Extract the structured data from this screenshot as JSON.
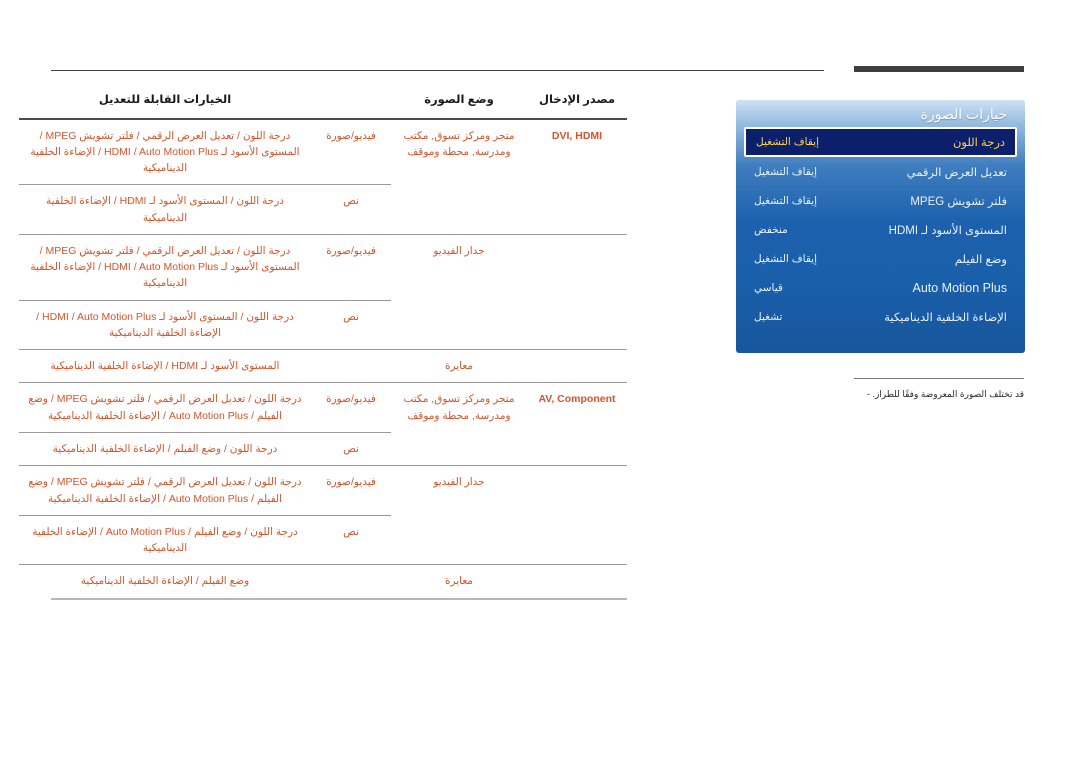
{
  "table": {
    "headers": {
      "source": "مصدر الإدخال",
      "picture_mode": "وضع الصورة",
      "options": "الخيارات القابلة للتعديل"
    },
    "rows": [
      {
        "source": "DVI, HDMI",
        "picture_mode": "متجر ومركز تسوق, مكتب ومدرسة, محطة وموقف",
        "sub_mode": "فيديو/صورة",
        "options": "درجة اللون / تعديل العرض الرقمي / فلتر تشويش MPEG / المستوى الأسود لـ HDMI / Auto Motion Plus / الإضاءة الخلفية الديناميكية"
      },
      {
        "source": "",
        "picture_mode": "",
        "sub_mode": "نص",
        "options": "درجة اللون / المستوى الأسود لـ HDMI / الإضاءة الخلفية الديناميكية"
      },
      {
        "source": "",
        "picture_mode": "جدار الفيديو",
        "sub_mode": "فيديو/صورة",
        "options": "درجة اللون / تعديل العرض الرقمي / فلتر تشويش MPEG / المستوى الأسود لـ HDMI / Auto Motion Plus / الإضاءة الخلفية الديناميكية"
      },
      {
        "source": "",
        "picture_mode": "",
        "sub_mode": "نص",
        "options": "درجة اللون / المستوى الأسود لـ HDMI / Auto Motion Plus / الإضاءة الخلفية الديناميكية"
      },
      {
        "source": "",
        "picture_mode": "معايرة",
        "sub_mode": "",
        "options": "المستوى الأسود لـ HDMI / الإضاءة الخلفية الديناميكية"
      },
      {
        "source": "AV, Component",
        "picture_mode": "متجر ومركز تسوق, مكتب ومدرسة, محطة وموقف",
        "sub_mode": "فيديو/صورة",
        "options": "درجة اللون / تعديل العرض الرقمي / فلتر تشويش MPEG / وضع الفيلم / Auto Motion Plus / الإضاءة الخلفية الديناميكية"
      },
      {
        "source": "",
        "picture_mode": "",
        "sub_mode": "نص",
        "options": "درجة اللون / وضع الفيلم / الإضاءة الخلفية الديناميكية"
      },
      {
        "source": "",
        "picture_mode": "جدار الفيديو",
        "sub_mode": "فيديو/صورة",
        "options": "درجة اللون / تعديل العرض الرقمي / فلتر تشويش MPEG / وضع الفيلم / Auto Motion Plus / الإضاءة الخلفية الديناميكية"
      },
      {
        "source": "",
        "picture_mode": "",
        "sub_mode": "نص",
        "options": "درجة اللون / وضع الفيلم / Auto Motion Plus / الإضاءة الخلفية الديناميكية"
      },
      {
        "source": "",
        "picture_mode": "معايرة",
        "sub_mode": "",
        "options": "وضع الفيلم / الإضاءة الخلفية الديناميكية"
      }
    ]
  },
  "osd": {
    "title": "خيارات الصورة",
    "items": [
      {
        "label": "درجة اللون",
        "value": "إيقاف التشغيل",
        "selected": true
      },
      {
        "label": "تعديل العرض الرقمي",
        "value": "إيقاف التشغيل",
        "selected": false
      },
      {
        "label": "فلتر تشويش MPEG",
        "value": "إيقاف التشغيل",
        "selected": false
      },
      {
        "label": "المستوى الأسود لـ HDMI",
        "value": "منخفض",
        "selected": false
      },
      {
        "label": "وضع الفيلم",
        "value": "إيقاف التشغيل",
        "selected": false
      },
      {
        "label": "Auto Motion Plus",
        "value": "قياسي",
        "selected": false
      },
      {
        "label": "الإضاءة الخلفية الديناميكية",
        "value": "تشغيل",
        "selected": false
      }
    ]
  },
  "note": {
    "dash": "-",
    "text": "قد تختلف الصورة المعروضة وفقًا للطراز."
  },
  "colors": {
    "table_text": "#d4542a",
    "header_text": "#1a1a1a",
    "osd_accent": "#ffd24a",
    "osd_selected_bg": "#0b1f6b",
    "rule": "#9a9a9a"
  }
}
